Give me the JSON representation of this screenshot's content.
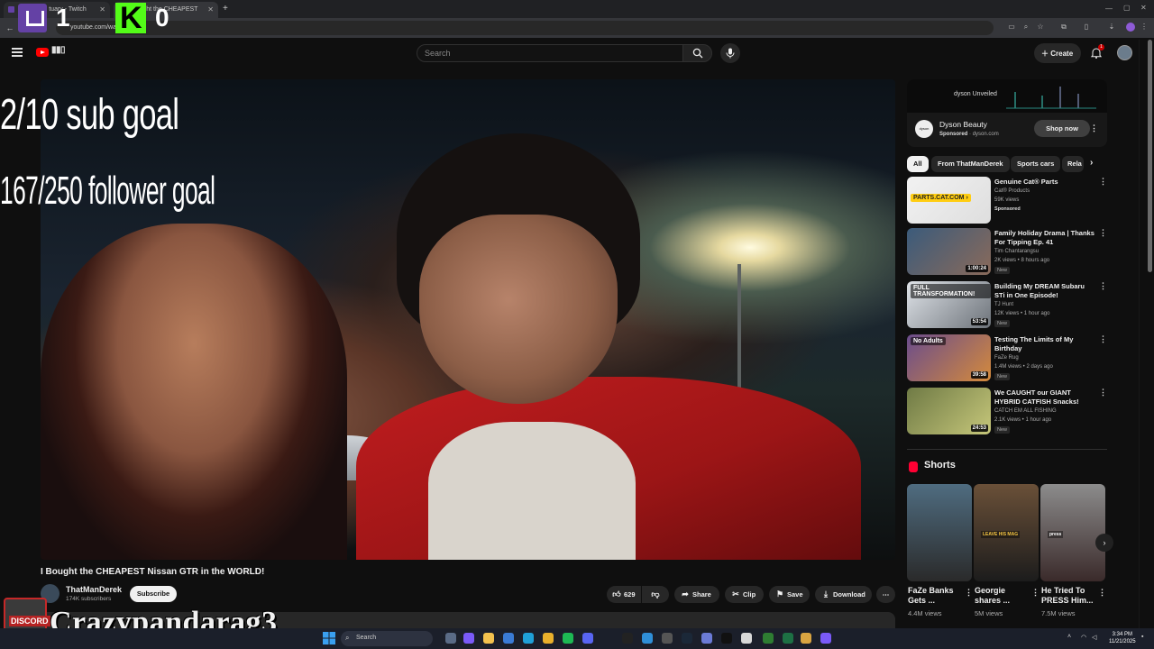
{
  "browser": {
    "tabs": [
      {
        "title": "yourDan... tuary - Twitch",
        "active": false
      },
      {
        "title": "I Bought the CHEAPEST",
        "active": true
      }
    ],
    "new_tab": "+",
    "url": "youtube.com/watch?v=...",
    "nav": {
      "back": "←",
      "reload": "⟳"
    }
  },
  "stream_overlay": {
    "twitch_count": "1",
    "kick_count": "0",
    "sub_goal": "2/10 sub goal",
    "follower_goal": "167/250 follower goal",
    "streamer_name": "Crazypandarag3",
    "discord_label": "DISCORD"
  },
  "youtube": {
    "search_placeholder": "Search",
    "create_label": "Create",
    "notification_count": "1",
    "video": {
      "title": "I Bought the CHEAPEST Nissan GTR in the WORLD!",
      "channel": "ThatManDerek",
      "subscribers": "174K subscribers",
      "subscribe_label": "Subscribe",
      "likes": "629",
      "share": "Share",
      "clip": "Clip",
      "save": "Save",
      "download": "Download"
    },
    "ad": {
      "banner": "dyson Unveiled",
      "name": "Dyson Beauty",
      "sponsored": "Sponsored",
      "domain": "dyson.com",
      "cta": "Shop now"
    },
    "chips": [
      "All",
      "From ThatManDerek",
      "Sports cars",
      "Rela"
    ],
    "recommendations": [
      {
        "title": "Genuine Cat® Parts",
        "channel": "Cat® Products",
        "meta": "59K views",
        "badge": "Sponsored",
        "duration": "",
        "thumb_text": "PARTS.CAT.COM ›",
        "colors": [
          "#f2f2f2",
          "#dedede"
        ]
      },
      {
        "title": "Family Holiday Drama | Thanks For Tipping Ep. 41",
        "channel": "Tim Chantarangsu",
        "meta": "2K views • 8 hours ago",
        "badge": "New",
        "duration": "1:00:24",
        "thumb_text": "",
        "colors": [
          "#3b5b7b",
          "#8a6a5a"
        ]
      },
      {
        "title": "Building My DREAM Subaru STi in One Episode!",
        "channel": "TJ Hunt",
        "meta": "12K views • 1 hour ago",
        "badge": "New",
        "duration": "53:54",
        "thumb_text": "FULL TRANSFORMATION!",
        "colors": [
          "#dfe3e8",
          "#6d737a"
        ]
      },
      {
        "title": "Testing The Limits of My Birthday",
        "channel": "FaZe Rug",
        "meta": "1.4M views • 2 days ago",
        "badge": "New",
        "duration": "39:58",
        "thumb_text": "No Adults",
        "colors": [
          "#6a4c8c",
          "#d48a3c"
        ]
      },
      {
        "title": "We CAUGHT our GIANT HYBRID CATFISH Snacks!",
        "channel": "CATCH EM ALL FISHING",
        "meta": "2.1K views • 1 hour ago",
        "badge": "New",
        "duration": "24:53",
        "thumb_text": "",
        "colors": [
          "#6f7a45",
          "#c6c77a"
        ]
      }
    ],
    "shorts_header": "Shorts",
    "shorts": [
      {
        "title": "FaZe Banks Gets ...",
        "views": "4.4M views",
        "colors": [
          "#4f6c80",
          "#2a2a2a"
        ]
      },
      {
        "title": "Georgie shares ...",
        "views": "5M views",
        "colors": [
          "#6a5038",
          "#1c1c1c"
        ],
        "caption": "LEAVE HIS MAG"
      },
      {
        "title": "He Tried To PRESS Him...",
        "views": "7.5M views",
        "colors": [
          "#8c8c8c",
          "#3a2a2a"
        ],
        "caption": "press"
      }
    ]
  },
  "taskbar": {
    "search": "Search",
    "time": "3:34 PM",
    "date": "11/21/2025"
  },
  "colors": {
    "youtube_red": "#ff0000",
    "twitch_purple": "#6441a5",
    "kick_green": "#53fc18"
  }
}
